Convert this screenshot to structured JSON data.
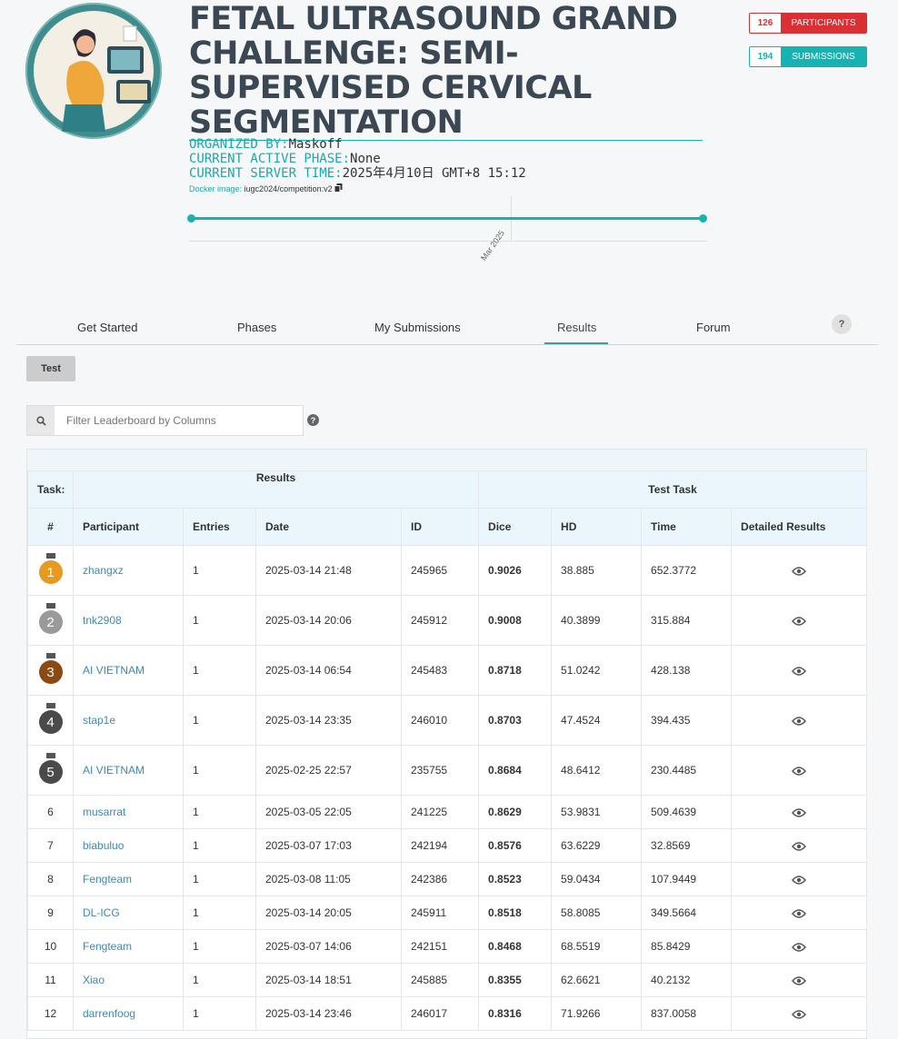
{
  "header": {
    "title": "FETAL ULTRASOUND GRAND CHALLENGE: SEMI-SUPERVISED CERVICAL SEGMENTATION",
    "participants_count": "126",
    "participants_label": "PARTICIPANTS",
    "submissions_count": "194",
    "submissions_label": "SUBMISSIONS"
  },
  "meta": {
    "organized_by_label": "ORGANIZED BY:",
    "organized_by_value": "Maskoff",
    "phase_label": "CURRENT ACTIVE PHASE:",
    "phase_value": "None",
    "server_time_label": "CURRENT SERVER TIME:",
    "server_time_value": "2025年4月10日 GMT+8 15:12",
    "docker_label": "Docker image:",
    "docker_value": "iugc2024/competition:v2"
  },
  "timeline": {
    "label": "Mar 2025"
  },
  "tabs": [
    "Get Started",
    "Phases",
    "My Submissions",
    "Results",
    "Forum"
  ],
  "active_tab": "Results",
  "help_label": "?",
  "phase_button": "Test",
  "filter": {
    "placeholder": "Filter Leaderboard by Columns"
  },
  "leaderboard": {
    "task_label": "Task:",
    "results_label": "Results",
    "test_task_label": "Test Task",
    "columns": [
      "#",
      "Participant",
      "Entries",
      "Date",
      "ID",
      "Dice",
      "HD",
      "Time",
      "Detailed Results"
    ],
    "rows": [
      {
        "rank": "1",
        "participant": "zhangxz",
        "entries": "1",
        "date": "2025-03-14 21:48",
        "id": "245965",
        "dice": "0.9026",
        "hd": "38.885",
        "time": "652.3772"
      },
      {
        "rank": "2",
        "participant": "tnk2908",
        "entries": "1",
        "date": "2025-03-14 20:06",
        "id": "245912",
        "dice": "0.9008",
        "hd": "40.3899",
        "time": "315.884"
      },
      {
        "rank": "3",
        "participant": "AI VIETNAM",
        "entries": "1",
        "date": "2025-03-14 06:54",
        "id": "245483",
        "dice": "0.8718",
        "hd": "51.0242",
        "time": "428.138"
      },
      {
        "rank": "4",
        "participant": "stap1e",
        "entries": "1",
        "date": "2025-03-14 23:35",
        "id": "246010",
        "dice": "0.8703",
        "hd": "47.4524",
        "time": "394.435"
      },
      {
        "rank": "5",
        "participant": "AI VIETNAM",
        "entries": "1",
        "date": "2025-02-25 22:57",
        "id": "235755",
        "dice": "0.8684",
        "hd": "48.6412",
        "time": "230.4485"
      },
      {
        "rank": "6",
        "participant": "musarrat",
        "entries": "1",
        "date": "2025-03-05 22:05",
        "id": "241225",
        "dice": "0.8629",
        "hd": "53.9831",
        "time": "509.4639"
      },
      {
        "rank": "7",
        "participant": "biabuluo",
        "entries": "1",
        "date": "2025-03-07 17:03",
        "id": "242194",
        "dice": "0.8576",
        "hd": "63.6229",
        "time": "32.8569"
      },
      {
        "rank": "8",
        "participant": "Fengteam",
        "entries": "1",
        "date": "2025-03-08 11:05",
        "id": "242386",
        "dice": "0.8523",
        "hd": "59.0434",
        "time": "107.9449"
      },
      {
        "rank": "9",
        "participant": "DL-ICG",
        "entries": "1",
        "date": "2025-03-14 20:05",
        "id": "245911",
        "dice": "0.8518",
        "hd": "58.8085",
        "time": "349.5664"
      },
      {
        "rank": "10",
        "participant": "Fengteam",
        "entries": "1",
        "date": "2025-03-07 14:06",
        "id": "242151",
        "dice": "0.8468",
        "hd": "68.5519",
        "time": "85.8429"
      },
      {
        "rank": "11",
        "participant": "Xiao",
        "entries": "1",
        "date": "2025-03-14 18:51",
        "id": "245885",
        "dice": "0.8355",
        "hd": "62.6621",
        "time": "40.2132"
      },
      {
        "rank": "12",
        "participant": "darrenfoog",
        "entries": "1",
        "date": "2025-03-14 23:46",
        "id": "246017",
        "dice": "0.8316",
        "hd": "71.9266",
        "time": "837.0058"
      }
    ]
  },
  "colors": {
    "accent": "#17b3b3",
    "participants_badge": "#dc2f33",
    "link": "#3f88b6",
    "gold": "#e79a1f",
    "silver": "#9a9a9a",
    "bronze": "#8a4a12",
    "dark_medal": "#4a4a4a"
  }
}
